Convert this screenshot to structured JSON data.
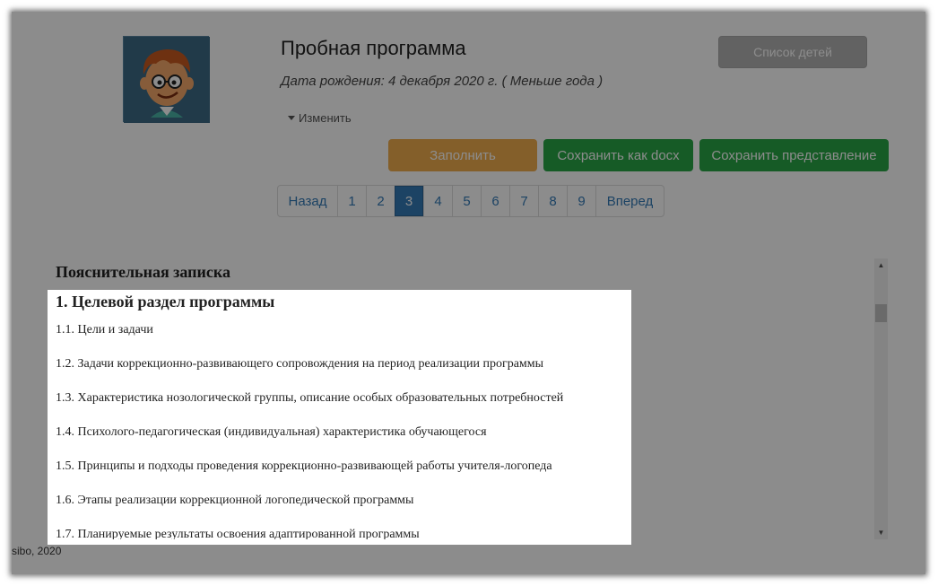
{
  "header": {
    "title": "Пробная программа",
    "dob": "Дата рождения: 4 декабря 2020 г. ( Меньше года )",
    "edit_label": "Изменить"
  },
  "buttons": {
    "kids_list": "Список детей",
    "fill": "Заполнить",
    "save_docx": "Сохранить как docx",
    "save_view": "Сохранить представление"
  },
  "colors": {
    "fill_button": "#f0ad4e",
    "save_buttons": "#28a745",
    "active_page": "#337ab7"
  },
  "pagination": {
    "prev": "Назад",
    "pages": [
      "1",
      "2",
      "3",
      "4",
      "5",
      "6",
      "7",
      "8",
      "9"
    ],
    "active": "3",
    "next": "Вперед"
  },
  "document": {
    "heading": "Пояснительная записка",
    "section_title": "1. Целевой раздел программы",
    "items": [
      "1.1. Цели и задачи",
      "1.2. Задачи коррекционно-развивающего сопровождения на период реализации программы",
      "1.3. Характеристика нозологической группы, описание особых образовательных потребностей",
      "1.4. Психолого-педагогическая (индивидуальная) характеристика обучающегося",
      "1.5. Принципы и подходы проведения коррекционно-развивающей работы учителя-логопеда",
      "1.6. Этапы реализации коррекционной логопедической программы",
      "1.7. Планируемые результаты освоения адаптированной программы"
    ]
  },
  "footer": {
    "text": "sibo, 2020"
  },
  "icons": {
    "avatar": "boy-avatar",
    "edit_caret": "caret-down-icon",
    "scroll_up": "arrow-up-icon",
    "scroll_down": "arrow-down-icon"
  }
}
